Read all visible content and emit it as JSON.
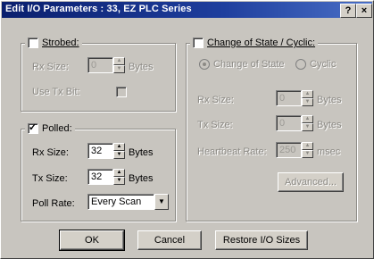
{
  "window": {
    "title": "Edit I/O Parameters : 33, EZ PLC Series",
    "help_label": "?",
    "close_label": "×"
  },
  "strobed": {
    "label": "Strobed:",
    "rx_size_label": "Rx Size:",
    "rx_size_value": "0",
    "bytes_label": "Bytes",
    "use_tx_bit_label": "Use Tx Bit:"
  },
  "polled": {
    "label": "Polled:",
    "rx_size_label": "Rx Size:",
    "rx_size_value": "32",
    "tx_size_label": "Tx Size:",
    "tx_size_value": "32",
    "bytes_label": "Bytes",
    "poll_rate_label": "Poll Rate:",
    "poll_rate_value": "Every Scan"
  },
  "cos": {
    "label": "Change of State / Cyclic:",
    "radio_cos_label": "Change of State",
    "radio_cyclic_label": "Cyclic",
    "rx_size_label": "Rx Size:",
    "rx_size_value": "0",
    "tx_size_label": "Tx Size:",
    "tx_size_value": "0",
    "bytes_label": "Bytes",
    "heartbeat_label": "Heartbeat Rate:",
    "heartbeat_value": "250",
    "msec_label": "msec",
    "advanced_label": "Advanced..."
  },
  "buttons": {
    "ok": "OK",
    "cancel": "Cancel",
    "restore": "Restore I/O Sizes"
  }
}
